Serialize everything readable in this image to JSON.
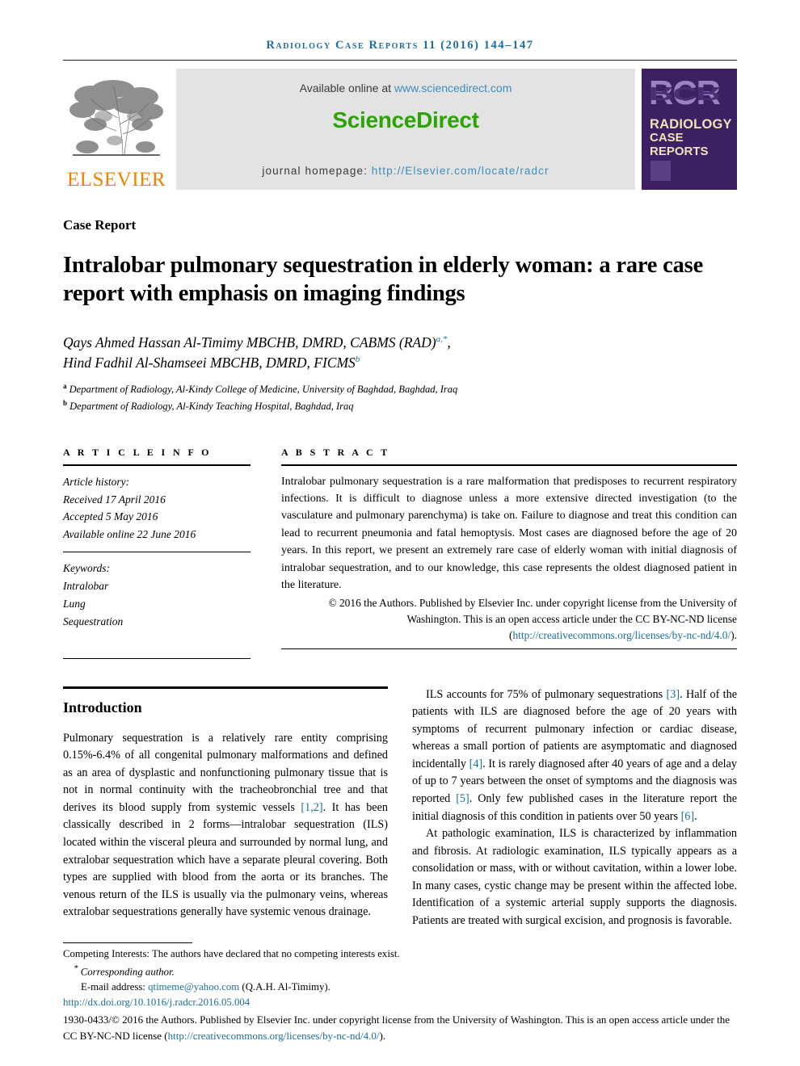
{
  "running_head": "Radiology Case Reports 11 (2016) 144–147",
  "masthead": {
    "elsevier_wordmark": "ELSEVIER",
    "available_prefix": "Available online at ",
    "available_link": "www.sciencedirect.com",
    "sciencedirect_brand": "ScienceDirect",
    "homepage_prefix": "journal homepage: ",
    "homepage_link": "http://Elsevier.com/locate/radcr",
    "rcr": {
      "acronym": "RCR",
      "line1": "RADIOLOGY",
      "line2": "CASE",
      "line3": "REPORTS"
    }
  },
  "article": {
    "kind": "Case Report",
    "title": "Intralobar pulmonary sequestration in elderly woman: a rare case report with emphasis on imaging findings",
    "author_line_1": "Qays Ahmed Hassan Al-Timimy MBCHB, DMRD, CABMS (RAD)",
    "author_line_1_sup": "a,*",
    "author_line_1_tail": ",",
    "author_line_2": "Hind Fadhil Al-Shamseei MBCHB, DMRD, FICMS",
    "author_line_2_sup": "b",
    "affiliations": [
      {
        "mark": "a",
        "text": "Department of Radiology, Al-Kindy College of Medicine, University of Baghdad, Baghdad, Iraq"
      },
      {
        "mark": "b",
        "text": "Department of Radiology, Al-Kindy Teaching Hospital, Baghdad, Iraq"
      }
    ]
  },
  "article_info": {
    "heading": "A R T I C L E   I N F O",
    "history_label": "Article history:",
    "received": "Received 17 April 2016",
    "accepted": "Accepted 5 May 2016",
    "available_online": "Available online 22 June 2016",
    "keywords_label": "Keywords:",
    "keywords": [
      "Intralobar",
      "Lung",
      "Sequestration"
    ]
  },
  "abstract": {
    "heading": "A B S T R A C T",
    "text": "Intralobar pulmonary sequestration is a rare malformation that predisposes to recurrent respiratory infections. It is difficult to diagnose unless a more extensive directed investigation (to the vasculature and pulmonary parenchyma) is take on. Failure to diagnose and treat this condition can lead to recurrent pneumonia and fatal hemoptysis. Most cases are diagnosed before the age of 20 years. In this report, we present an extremely rare case of elderly woman with initial diagnosis of intralobar sequestration, and to our knowledge, this case represents the oldest diagnosed patient in the literature.",
    "copyright": "© 2016 the Authors. Published by Elsevier Inc. under copyright license from the University of Washington. This is an open access article under the CC BY-NC-ND license (",
    "license_link": "http://creativecommons.org/licenses/by-nc-nd/4.0/",
    "copyright_tail": ")."
  },
  "body": {
    "intro_heading": "Introduction",
    "left_paragraph": "Pulmonary sequestration is a relatively rare entity comprising 0.15%-6.4% of all congenital pulmonary malformations and defined as an area of dysplastic and nonfunctioning pulmonary tissue that is not in normal continuity with the tracheobronchial tree and that derives its blood supply from systemic vessels ",
    "left_ref_1": "[1,2]",
    "left_paragraph_cont": ". It has been classically described in 2 forms—intralobar sequestration (ILS) located within the visceral pleura and surrounded by normal lung, and extralobar sequestration which have a separate pleural covering. Both types are supplied with blood from the aorta or its branches. The venous return of the ILS is usually via the pulmonary veins, whereas extralobar sequestrations generally have systemic venous drainage.",
    "right_p1_a": "ILS accounts for 75% of pulmonary sequestrations ",
    "right_ref_3": "[3]",
    "right_p1_b": ". Half of the patients with ILS are diagnosed before the age of 20 years with symptoms of recurrent pulmonary infection or cardiac disease, whereas a small portion of patients are asymptomatic and diagnosed incidentally ",
    "right_ref_4": "[4]",
    "right_p1_c": ". It is rarely diagnosed after 40 years of age and a delay of up to 7 years between the onset of symptoms and the diagnosis was reported ",
    "right_ref_5": "[5]",
    "right_p1_d": ". Only few published cases in the literature report the initial diagnosis of this condition in patients over 50 years ",
    "right_ref_6": "[6]",
    "right_p1_e": ".",
    "right_p2": "At pathologic examination, ILS is characterized by inflammation and fibrosis. At radiologic examination, ILS typically appears as a consolidation or mass, with or without cavitation, within a lower lobe. In many cases, cystic change may be present within the affected lobe. Identification of a systemic arterial supply supports the diagnosis. Patients are treated with surgical excision, and prognosis is favorable."
  },
  "footnotes": {
    "competing": "Competing Interests: The authors have declared that no competing interests exist.",
    "corresponding": "Corresponding author.",
    "email_label": "E-mail address: ",
    "email": "qtimeme@yahoo.com",
    "email_tail": " (Q.A.H. Al-Timimy).",
    "doi": "http://dx.doi.org/10.1016/j.radcr.2016.05.004",
    "legal_a": "1930-0433/© 2016 the Authors. Published by Elsevier Inc. under copyright license from the University of Washington. This is an open access article under the CC BY-NC-ND license (",
    "legal_link": "http://creativecommons.org/licenses/by-nc-nd/4.0/",
    "legal_b": ")."
  },
  "colors": {
    "link": "#1b6e9e",
    "sciencedirect_green": "#2ba404",
    "elsevier_orange": "#ef8200",
    "rcr_purple": "#3c2064"
  }
}
